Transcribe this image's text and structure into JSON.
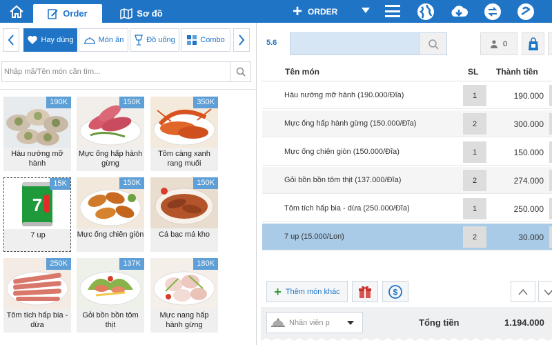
{
  "topbar": {
    "tabs": [
      {
        "label": ""
      },
      {
        "label": "Order"
      },
      {
        "label": "Sơ đồ"
      }
    ],
    "add_order_label": "ORDER",
    "icons": [
      "globe-icon",
      "cloud-download-icon",
      "sync-icon",
      "no-service-icon"
    ]
  },
  "categories": {
    "items": [
      {
        "label": "Hay dùng",
        "icon": "heart-icon",
        "active": true
      },
      {
        "label": "Món ăn",
        "icon": "dish-icon",
        "active": false
      },
      {
        "label": "Đồ uống",
        "icon": "drink-icon",
        "active": false
      },
      {
        "label": "Combo",
        "icon": "combo-icon",
        "active": false
      }
    ]
  },
  "menu_search": {
    "placeholder": "Nhập mã/Tên món cần tìm...",
    "value": ""
  },
  "menu_items": [
    {
      "name": "Hàu nướng mỡ hành",
      "price": "190K"
    },
    {
      "name": "Mực ống hấp hành gừng",
      "price": "150K"
    },
    {
      "name": "Tôm càng xanh rang muối",
      "price": "350K"
    },
    {
      "name": "7 up",
      "price": "15K",
      "selected": true
    },
    {
      "name": "Mực ống chiên giòn",
      "price": "150K"
    },
    {
      "name": "Cá bạc má kho",
      "price": "150K"
    },
    {
      "name": "Tôm tích hấp bia - dừa",
      "price": "250K"
    },
    {
      "name": "Gỏi bồn bồn tôm thịt",
      "price": "137K"
    },
    {
      "name": "Mực nang hấp hành gừng",
      "price": "180K"
    }
  ],
  "order": {
    "table_label": "5.6",
    "guest_count": "0",
    "headers": {
      "name": "Tên món",
      "qty": "SL",
      "total": "Thành tiền"
    },
    "rows": [
      {
        "name": "Hàu nướng mỡ hành (190.000/Đĩa)",
        "qty": "1",
        "total": "190.000"
      },
      {
        "name": "Mực ống hấp hành gừng (150.000/Đĩa)",
        "qty": "2",
        "total": "300.000"
      },
      {
        "name": "Mực ống chiên giòn (150.000/Đĩa)",
        "qty": "1",
        "total": "150.000"
      },
      {
        "name": "Gỏi bồn bồn tôm thịt (137.000/Đĩa)",
        "qty": "2",
        "total": "274.000"
      },
      {
        "name": "Tôm tích hấp bia - dừa (250.000/Đĩa)",
        "qty": "1",
        "total": "250.000"
      },
      {
        "name": "7 up (15.000/Lon)",
        "qty": "2",
        "total": "30.000",
        "selected": true
      }
    ],
    "add_more_label": "Thêm món khác",
    "staff_placeholder": "Nhân viên p",
    "total_label": "Tổng tiền",
    "total_value": "1.194.000"
  },
  "colors": {
    "primary": "#1f74c6",
    "price_badge": "#5d9fd6",
    "selected_row": "#a9cbe8"
  }
}
